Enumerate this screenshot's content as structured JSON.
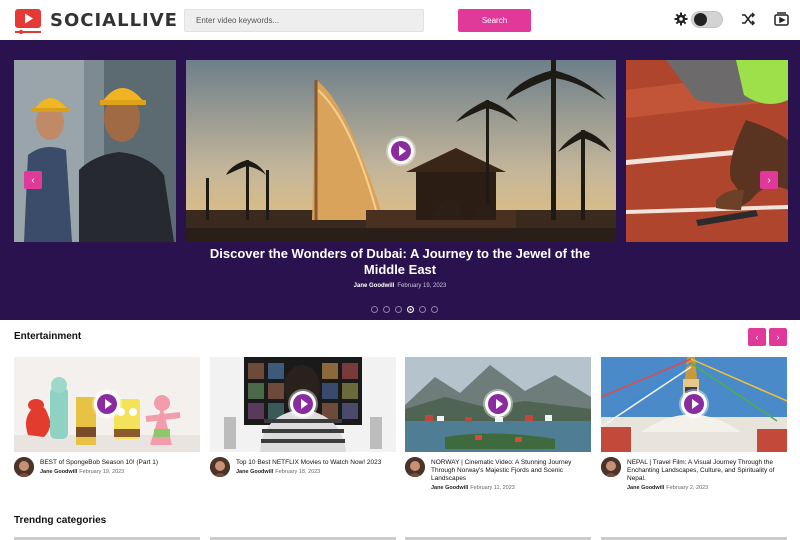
{
  "app": {
    "name": "SOCIALLIVE"
  },
  "search": {
    "placeholder": "Enter video keywords...",
    "button_label": "Search"
  },
  "header_icons": [
    "gear-icon",
    "theme-toggle",
    "shuffle-icon",
    "video-playlist-icon"
  ],
  "colors": {
    "accent": "#e0399a",
    "hero_bg": "#29124e",
    "play": "#8a2ca0",
    "logo_red": "#e53935"
  },
  "hero": {
    "title": "Discover the Wonders of Dubai: A Journey to the Jewel of the Middle East",
    "author": "Jane Goodwill",
    "date": "February 19, 2023",
    "slide_count": 6,
    "active_slide": 4
  },
  "entertainment": {
    "title": "Entertainment",
    "cards": [
      {
        "title": "BEST of SpongeBob Season 10! (Part 1)",
        "author": "Jane Goodwill",
        "date": "February 19, 2023"
      },
      {
        "title": "Top 10 Best NETFLIX Movies to Watch Now! 2023",
        "author": "Jane Goodwill",
        "date": "February 18, 2023"
      },
      {
        "title": "NORWAY | Cinematic Video: A Stunning Journey Through Norway's Majestic Fjords and Scenic Landscapes",
        "author": "Jane Goodwill",
        "date": "February 11, 2023"
      },
      {
        "title": "NEPAL | Travel Film: A Visual Journey Through the Enchanting Landscapes, Culture, and Spirituality of Nepal.",
        "author": "Jane Goodwill",
        "date": "February 2, 2023"
      }
    ]
  },
  "trending": {
    "title": "Trendng categories"
  }
}
